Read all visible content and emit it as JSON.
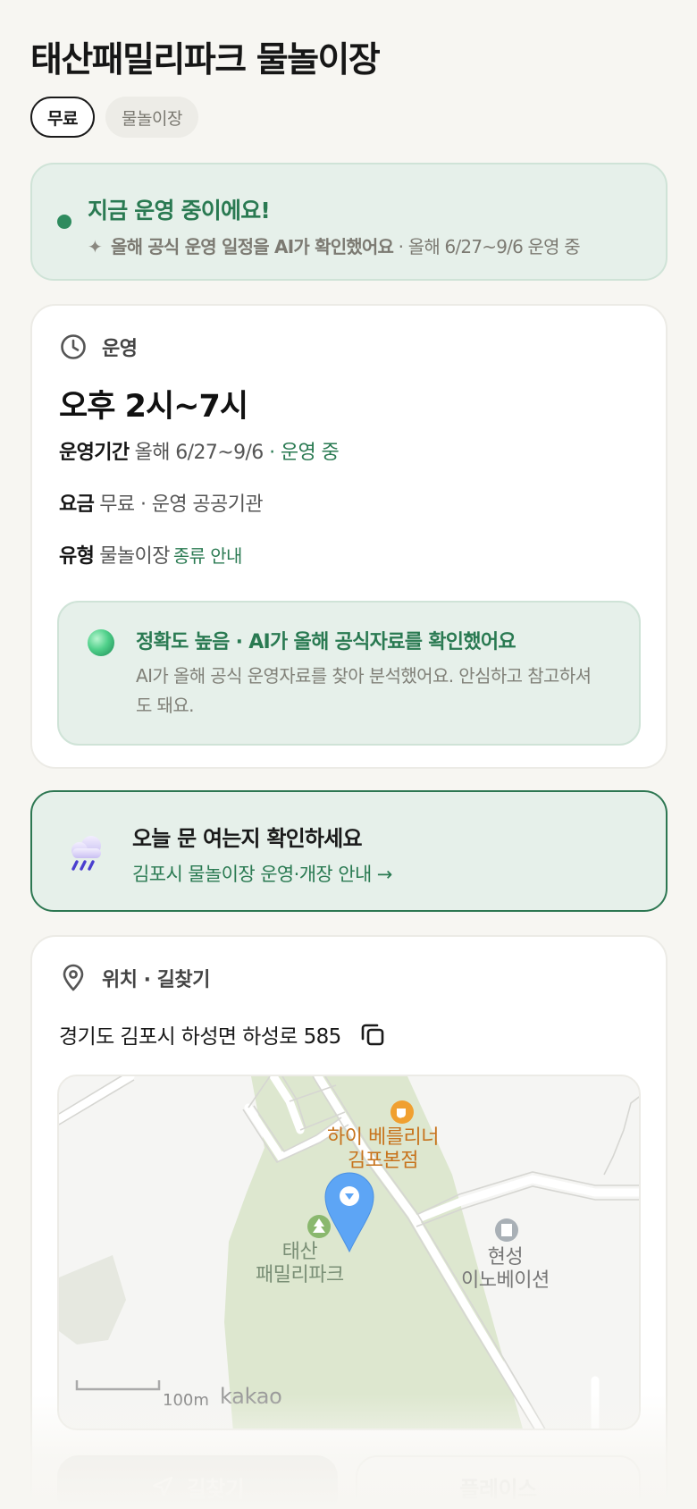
{
  "page": {
    "title": "태산패밀리파크 물놀이장",
    "chips": {
      "price": "무료",
      "type": "물놀이장"
    }
  },
  "status": {
    "title": "지금 운영 중이에요!",
    "sub_strong": "올해 공식 운영 일정을 AI가 확인했어요",
    "sub_rest": " · 올해 6/27~9/6 운영 중",
    "accent_color": "#2e8b5e"
  },
  "hours": {
    "section_title": "운영",
    "hours_text": "오후 2시~7시",
    "period_label": "운영기간",
    "period_value": "올해 6/27~9/6",
    "period_status": " · 운영 중",
    "fee_label": "요금",
    "fee_value": "무료 · 운영 공공기관",
    "type_label": "유형",
    "type_value": "물놀이장",
    "type_link": "종류 안내",
    "accuracy_title": "정확도 높음 · AI가 올해 공식자료를 확인했어요",
    "accuracy_body": "AI가 올해 공식 운영자료를 찾아 분석했어요. 안심하고 참고하셔도 돼요."
  },
  "notice": {
    "icon": "rain-cloud-icon",
    "title": "오늘 문 여는지 확인하세요",
    "link": "김포시 물놀이장 운영·개장 안내 →"
  },
  "location": {
    "section_title": "위치 · 길찾기",
    "address": "경기도 김포시 하성면 하성로 585",
    "map": {
      "poi_cafe": "하이 베를리너\n김포본점",
      "poi_park": "태산\n패밀리파크",
      "poi_company": "현성\n이노베이션",
      "scale": "100m",
      "brand": "kakao"
    },
    "buttons": {
      "directions": "길찾기",
      "place": "플레이스"
    }
  }
}
